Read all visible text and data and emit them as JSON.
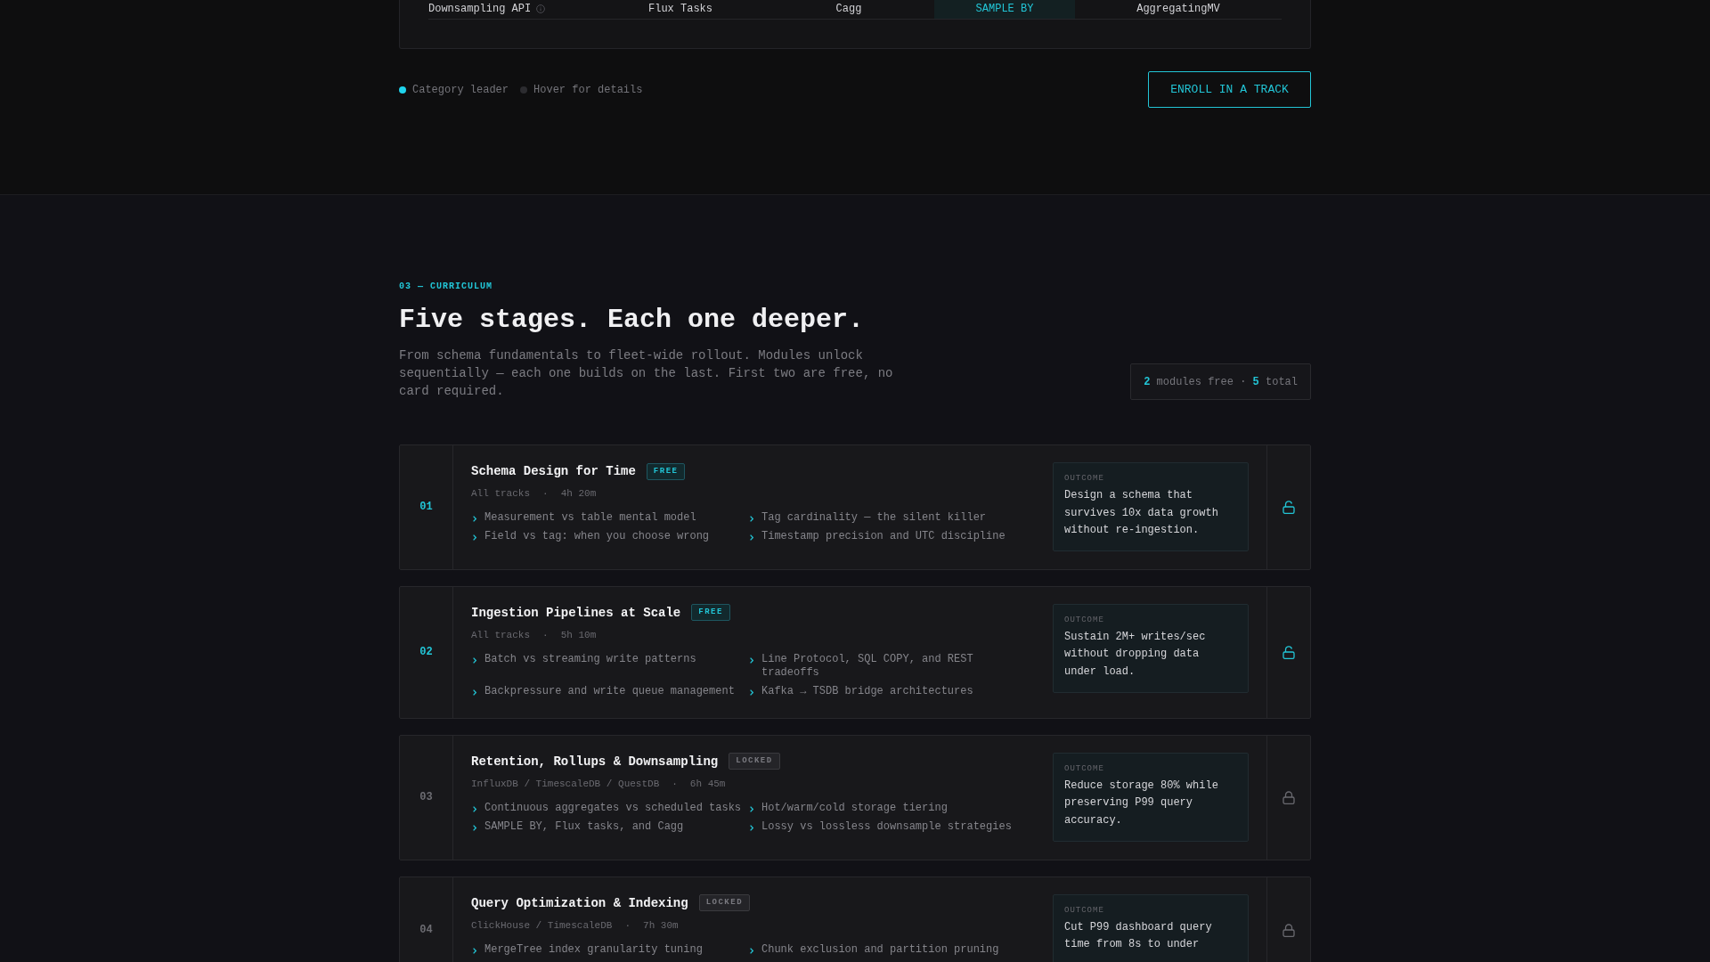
{
  "comparison_table": {
    "row": {
      "label": "Downsampling API",
      "cells": [
        {
          "text": "Flux Tasks",
          "leader": false
        },
        {
          "text": "Cagg",
          "leader": false
        },
        {
          "text": "SAMPLE BY",
          "leader": true
        },
        {
          "text": "AggregatingMV",
          "leader": false
        }
      ]
    }
  },
  "legend": [
    {
      "label": "Category leader",
      "color": "#1fd3ec"
    },
    {
      "label": "Hover for details",
      "color": "#2c2c30"
    }
  ],
  "enroll_button": {
    "label": "ENROLL IN A TRACK"
  },
  "curriculum": {
    "eyebrow": "03 — CURRICULUM",
    "heading": "Five stages. Each one deeper.",
    "description": "From schema fundamentals to fleet-wide rollout. Modules unlock sequentially — each one builds on the last. First two are free, no card required.",
    "summary": {
      "free_count": "2",
      "free_label": "modules free",
      "separator": "·",
      "total_count": "5",
      "total_label": "total"
    },
    "modules": [
      {
        "number": "01",
        "title": "Schema Design for Time",
        "badge": "FREE",
        "locked": false,
        "meta": {
          "tracks": "All tracks",
          "separator": "·",
          "duration": "4h 20m"
        },
        "topics": [
          "Measurement vs table mental model",
          "Tag cardinality — the silent killer",
          "Field vs tag: when you choose wrong",
          "Timestamp precision and UTC discipline"
        ],
        "outcome_label": "OUTCOME",
        "outcome": "Design a schema that survives 10x data growth without re-ingestion."
      },
      {
        "number": "02",
        "title": "Ingestion Pipelines at Scale",
        "badge": "FREE",
        "locked": false,
        "meta": {
          "tracks": "All tracks",
          "separator": "·",
          "duration": "5h 10m"
        },
        "topics": [
          "Batch vs streaming write patterns",
          "Line Protocol, SQL COPY, and REST tradeoffs",
          "Backpressure and write queue management",
          "Kafka → TSDB bridge architectures"
        ],
        "outcome_label": "OUTCOME",
        "outcome": "Sustain 2M+ writes/sec without dropping data under load."
      },
      {
        "number": "03",
        "title": "Retention, Rollups & Downsampling",
        "badge": "LOCKED",
        "locked": true,
        "meta": {
          "tracks": "InfluxDB / TimescaleDB / QuestDB",
          "separator": "·",
          "duration": "6h 45m"
        },
        "topics": [
          "Continuous aggregates vs scheduled tasks",
          "Hot/warm/cold storage tiering",
          "SAMPLE BY, Flux tasks, and Cagg",
          "Lossy vs lossless downsample strategies"
        ],
        "outcome_label": "OUTCOME",
        "outcome": "Reduce storage 80% while preserving P99 query accuracy."
      },
      {
        "number": "04",
        "title": "Query Optimization & Indexing",
        "badge": "LOCKED",
        "locked": true,
        "meta": {
          "tracks": "ClickHouse / TimescaleDB",
          "separator": "·",
          "duration": "7h 30m"
        },
        "topics": [
          "MergeTree index granularity tuning",
          "Chunk exclusion and partition pruning"
        ],
        "outcome_label": "OUTCOME",
        "outcome": "Cut P99 dashboard query time from 8s to under"
      }
    ]
  }
}
